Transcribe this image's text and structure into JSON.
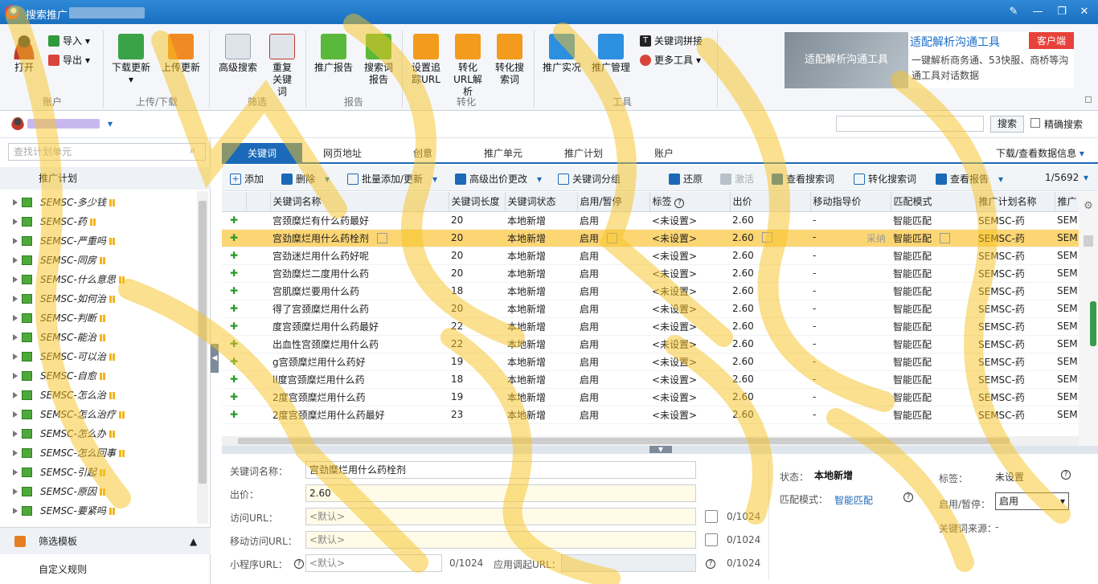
{
  "app": {
    "title": "搜索推广"
  },
  "ribbon": {
    "account": {
      "open": "打开",
      "import": "导入",
      "export": "导出",
      "group": "账户"
    },
    "updown": {
      "download": "下载更新",
      "upload": "上传更新",
      "group": "上传/下载"
    },
    "filter": {
      "adv_search": "高级搜索",
      "dup_keyword": "重复关键词",
      "group": "筛选"
    },
    "report": {
      "promo_report": "推广报告",
      "search_word_report": "搜索词报告",
      "group": "报告"
    },
    "conversion": {
      "set_url": "设置追踪URL",
      "conv_url": "转化URL解析",
      "conv_search": "转化搜索词",
      "group": "转化"
    },
    "tools": {
      "live": "推广实况",
      "manage": "推广管理",
      "kw_combine": "关键词拼接",
      "more": "更多工具",
      "group": "工具"
    },
    "banner": {
      "image_text": "适配解析沟通工具",
      "title": "适配解析沟通工具",
      "tag": "客户端",
      "desc": "一键解析商务通、53快服、商桥等沟通工具对话数据"
    }
  },
  "userbar": {
    "search_btn": "搜索",
    "exact": "精确搜索"
  },
  "left": {
    "search_placeholder": "查找计划单元",
    "header": "推广计划",
    "plans": [
      "SEMSC-多少钱",
      "SEMSC-药",
      "SEMSC-严重吗",
      "SEMSC-同房",
      "SEMSC-什么意思",
      "SEMSC-如何治",
      "SEMSC-判断",
      "SEMSC-能治",
      "SEMSC-可以治",
      "SEMSC-自愈",
      "SEMSC-怎么治",
      "SEMSC-怎么治疗",
      "SEMSC-怎么办",
      "SEMSC-怎么回事",
      "SEMSC-引起",
      "SEMSC-原因",
      "SEMSC-要紧吗"
    ],
    "filter_template": "筛选模板",
    "custom_rule": "自定义规则"
  },
  "tabs": [
    "关键词",
    "网页地址",
    "创意",
    "推广单元",
    "推广计划",
    "账户"
  ],
  "tabs_right": "下载/查看数据信息",
  "toolbar": {
    "add": "添加",
    "delete": "删除",
    "batch": "批量添加/更新",
    "bid": "高级出价更改",
    "group": "关键词分组",
    "restore": "还原",
    "activate": "激活",
    "view_search": "查看搜索词",
    "conv_search": "转化搜索词",
    "view_report": "查看报告",
    "page": "1/5692"
  },
  "grid": {
    "columns": [
      "",
      "关键词名称",
      "关键词长度",
      "关键词状态",
      "启用/暂停",
      "标签",
      "出价",
      "移动指导价",
      "匹配模式",
      "推广计划名称",
      "推广"
    ],
    "rows": [
      {
        "kw": "宫颈糜烂有什么药最好",
        "len": "20",
        "status": "本地新增",
        "on": "启用",
        "tag": "<未设置>",
        "bid": "2.60",
        "mob": "-",
        "match": "智能匹配",
        "plan": "SEMSC-药",
        "unit": "SEM"
      },
      {
        "kw": "宫劲糜烂用什么药栓剂",
        "len": "20",
        "status": "本地新增",
        "on": "启用",
        "tag": "<未设置>",
        "bid": "2.60",
        "mob": "-",
        "match": "智能匹配",
        "plan": "SEMSC-药",
        "unit": "SEM",
        "note": "采纳"
      },
      {
        "kw": "宫劲迷烂用什么药好呢",
        "len": "20",
        "status": "本地新增",
        "on": "启用",
        "tag": "<未设置>",
        "bid": "2.60",
        "mob": "-",
        "match": "智能匹配",
        "plan": "SEMSC-药",
        "unit": "SEM"
      },
      {
        "kw": "宫劲糜烂二度用什么药",
        "len": "20",
        "status": "本地新增",
        "on": "启用",
        "tag": "<未设置>",
        "bid": "2.60",
        "mob": "-",
        "match": "智能匹配",
        "plan": "SEMSC-药",
        "unit": "SEM"
      },
      {
        "kw": "宫肌糜烂要用什么药",
        "len": "18",
        "status": "本地新增",
        "on": "启用",
        "tag": "<未设置>",
        "bid": "2.60",
        "mob": "-",
        "match": "智能匹配",
        "plan": "SEMSC-药",
        "unit": "SEM"
      },
      {
        "kw": "得了宫颈糜烂用什么药",
        "len": "20",
        "status": "本地新增",
        "on": "启用",
        "tag": "<未设置>",
        "bid": "2.60",
        "mob": "-",
        "match": "智能匹配",
        "plan": "SEMSC-药",
        "unit": "SEM"
      },
      {
        "kw": "度宫颈糜烂用什么药最好",
        "len": "22",
        "status": "本地新增",
        "on": "启用",
        "tag": "<未设置>",
        "bid": "2.60",
        "mob": "-",
        "match": "智能匹配",
        "plan": "SEMSC-药",
        "unit": "SEM"
      },
      {
        "kw": "出血性宫颈糜烂用什么药",
        "len": "22",
        "status": "本地新增",
        "on": "启用",
        "tag": "<未设置>",
        "bid": "2.60",
        "mob": "-",
        "match": "智能匹配",
        "plan": "SEMSC-药",
        "unit": "SEM"
      },
      {
        "kw": "g宫颈糜烂用什么药好",
        "len": "19",
        "status": "本地新增",
        "on": "启用",
        "tag": "<未设置>",
        "bid": "2.60",
        "mob": "-",
        "match": "智能匹配",
        "plan": "SEMSC-药",
        "unit": "SEM"
      },
      {
        "kw": "ll度宫颈糜烂用什么药",
        "len": "18",
        "status": "本地新增",
        "on": "启用",
        "tag": "<未设置>",
        "bid": "2.60",
        "mob": "-",
        "match": "智能匹配",
        "plan": "SEMSC-药",
        "unit": "SEM"
      },
      {
        "kw": "2度宫颈糜烂用什么药",
        "len": "19",
        "status": "本地新增",
        "on": "启用",
        "tag": "<未设置>",
        "bid": "2.60",
        "mob": "-",
        "match": "智能匹配",
        "plan": "SEMSC-药",
        "unit": "SEM"
      },
      {
        "kw": "2度宫颈糜烂用什么药最好",
        "len": "23",
        "status": "本地新增",
        "on": "启用",
        "tag": "<未设置>",
        "bid": "2.60",
        "mob": "-",
        "match": "智能匹配",
        "plan": "SEMSC-药",
        "unit": "SEM"
      }
    ]
  },
  "detail": {
    "kw_label": "关键词名称：",
    "kw_value": "宫劲糜烂用什么药栓剂",
    "bid_label": "出价：",
    "bid_value": "2.60",
    "url_label": "访问URL：",
    "url_ph": "<默认>",
    "murl_label": "移动访问URL：",
    "murl_ph": "<默认>",
    "mini_label": "小程序URL：",
    "mini_ph": "<默认>",
    "mini_count": "0/1024",
    "app_label": "应用调起URL：",
    "count": "0/1024",
    "status_label": "状态：",
    "status_value": "本地新增",
    "match_label": "匹配模式：",
    "match_value": "智能匹配",
    "tag_label": "标签：",
    "tag_value": "未设置",
    "onoff_label": "启用/暂停：",
    "onoff_value": "启用",
    "source_label": "关键词来源：",
    "source_value": "-"
  },
  "colors": {
    "accent": "#1b69b8",
    "selected_row": "#fdd674",
    "watermark": "#f7c322"
  }
}
